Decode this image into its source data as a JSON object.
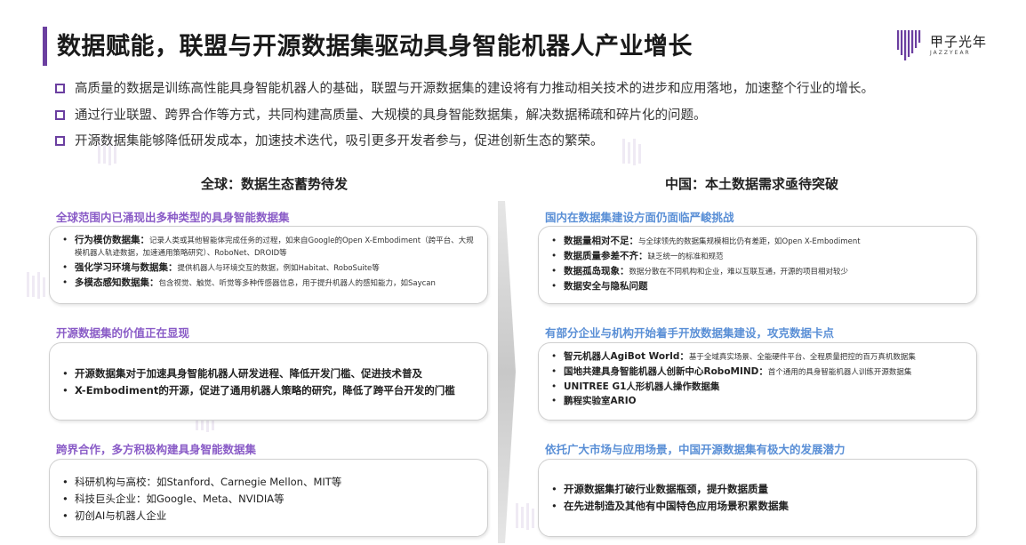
{
  "header": {
    "title": "数据赋能，联盟与开源数据集驱动具身智能机器人产业增长",
    "logo_cn": "甲子光年",
    "logo_en": "JAZZYEAR",
    "accent_color": "#6b3fa0"
  },
  "bullets": [
    "高质量的数据是训练高性能具身智能机器人的基础，联盟与开源数据集的建设将有力推动相关技术的进步和应用落地，加速整个行业的增长。",
    "通过行业联盟、跨界合作等方式，共同构建高质量、大规模的具身智能数据集，解决数据稀疏和碎片化的问题。",
    "开源数据集能够降低研发成本，加速技术迭代，吸引更多开发者参与，促进创新生态的繁荣。"
  ],
  "left": {
    "column_title": "全球：数据生态蓄势待发",
    "sections": [
      {
        "heading": "全球范围内已涌现出多种类型的具身智能数据集",
        "items": [
          {
            "key": "行为模仿数据集：",
            "desc": "记录人类或其他智能体完成任务的过程，如来自Google的Open X-Embodiment（跨平台、大规模机器人轨迹数据，加速通用策略研究）、RoboNet、DROID等"
          },
          {
            "key": "强化学习环境与数据集：",
            "desc": "提供机器人与环境交互的数据，例如Habitat、RoboSuite等"
          },
          {
            "key": "多模态感知数据集：",
            "desc": "包含视觉、触觉、听觉等多种传感器信息，用于提升机器人的感知能力，如Saycan"
          }
        ]
      },
      {
        "heading": "开源数据集的价值正在显现",
        "items": [
          {
            "key": "开源数据集对于加速具身智能机器人研发进程、降低开发门槛、促进技术普及",
            "desc": ""
          },
          {
            "key": "X-Embodiment的开源，促进了通用机器人策略的研究，降低了跨平台开发的门槛",
            "desc": ""
          }
        ]
      },
      {
        "heading": "跨界合作，多方积极构建具身智能数据集",
        "items": [
          {
            "key": "科研机构与高校：如Stanford、Carnegie Mellon、MIT等",
            "desc": ""
          },
          {
            "key": "科技巨头企业：如Google、Meta、NVIDIA等",
            "desc": ""
          },
          {
            "key": "初创AI与机器人企业",
            "desc": ""
          }
        ]
      }
    ]
  },
  "right": {
    "column_title": "中国：本土数据需求亟待突破",
    "sections": [
      {
        "heading": "国内在数据集建设方面仍面临严峻挑战",
        "items": [
          {
            "key": "数据量相对不足：",
            "desc": "与全球领先的数据集规模相比仍有差距，如Open X-Embodiment"
          },
          {
            "key": "数据质量参差不齐：",
            "desc": "缺乏统一的标准和规范"
          },
          {
            "key": "数据孤岛现象：",
            "desc": "数据分散在不同机构和企业，难以互联互通，开源的项目相对较少"
          },
          {
            "key": "数据安全与隐私问题",
            "desc": ""
          }
        ]
      },
      {
        "heading": "有部分企业与机构开始着手开放数据集建设，攻克数据卡点",
        "items": [
          {
            "key": "智元机器人AgiBot World：",
            "desc": "基于全域真实场景、全能硬件平台、全程质量把控的百万真机数据集"
          },
          {
            "key": "国地共建具身智能机器人创新中心RoboMIND：",
            "desc": "首个通用的具身智能机器人训练开源数据集"
          },
          {
            "key": "UNITREE G1人形机器人操作数据集",
            "desc": ""
          },
          {
            "key": "鹏程实验室ARIO",
            "desc": ""
          }
        ]
      },
      {
        "heading": "依托广大市场与应用场景，中国开源数据集有极大的发展潜力",
        "items": [
          {
            "key": "开源数据集打破行业数据瓶颈，提升数据质量",
            "desc": ""
          },
          {
            "key": "在先进制造及其他有中国特色应用场景积累数据集",
            "desc": ""
          }
        ]
      }
    ]
  }
}
